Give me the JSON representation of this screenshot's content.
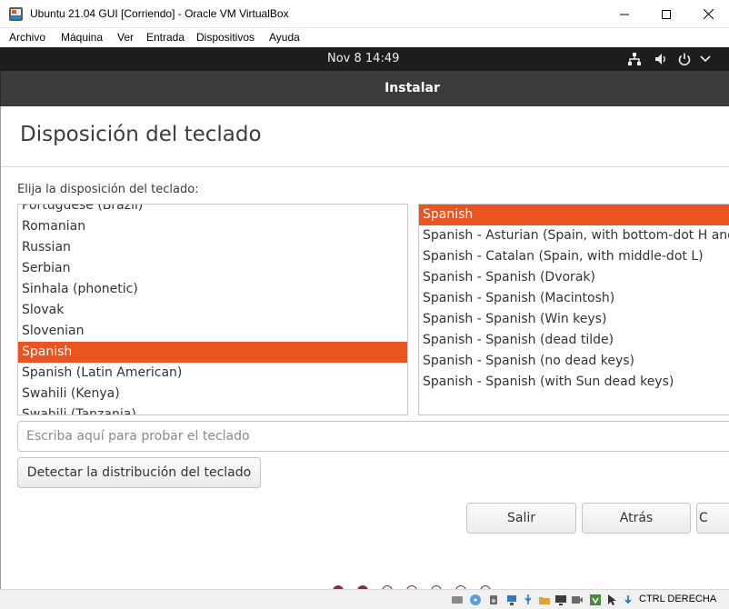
{
  "vbox": {
    "title": "Ubuntu 21.04 GUI [Corriendo] - Oracle VM VirtualBox",
    "menu": [
      "Archivo",
      "Máquina",
      "Ver",
      "Entrada",
      "Dispositivos",
      "Ayuda"
    ],
    "host_key": "CTRL DERECHA"
  },
  "topbar": {
    "clock": "Nov 8  14:49",
    "icons": [
      "network-icon",
      "volume-icon",
      "power-icon",
      "chevron-down-icon"
    ]
  },
  "installer": {
    "header": "Instalar",
    "page_title": "Disposición del teclado",
    "choose_label": "Elija la disposición del teclado:",
    "layouts": [
      "Portuguese (Brazil)",
      "Romanian",
      "Russian",
      "Serbian",
      "Sinhala (phonetic)",
      "Slovak",
      "Slovenian",
      "Spanish",
      "Spanish (Latin American)",
      "Swahili (Kenya)",
      "Swahili (Tanzania)"
    ],
    "selected_layout": "Spanish",
    "variants": [
      "Spanish",
      "Spanish - Asturian (Spain, with bottom-dot H and b",
      "Spanish - Catalan (Spain, with middle-dot L)",
      "Spanish - Spanish (Dvorak)",
      "Spanish - Spanish (Macintosh)",
      "Spanish - Spanish (Win keys)",
      "Spanish - Spanish (dead tilde)",
      "Spanish - Spanish (no dead keys)",
      "Spanish - Spanish (with Sun dead keys)"
    ],
    "selected_variant": "Spanish",
    "test_placeholder": "Escriba aquí para probar el teclado",
    "detect_button": "Detectar la distribución del teclado",
    "quit_button": "Salir",
    "back_button": "Atrás",
    "continue_button": "C",
    "progress": {
      "completed_steps": 2,
      "total_steps": 7
    }
  },
  "colors": {
    "accent": "#e95420",
    "progress_dot": "#7d2b55",
    "topbar": "#1d1d1d",
    "header": "#3b3b3b"
  }
}
